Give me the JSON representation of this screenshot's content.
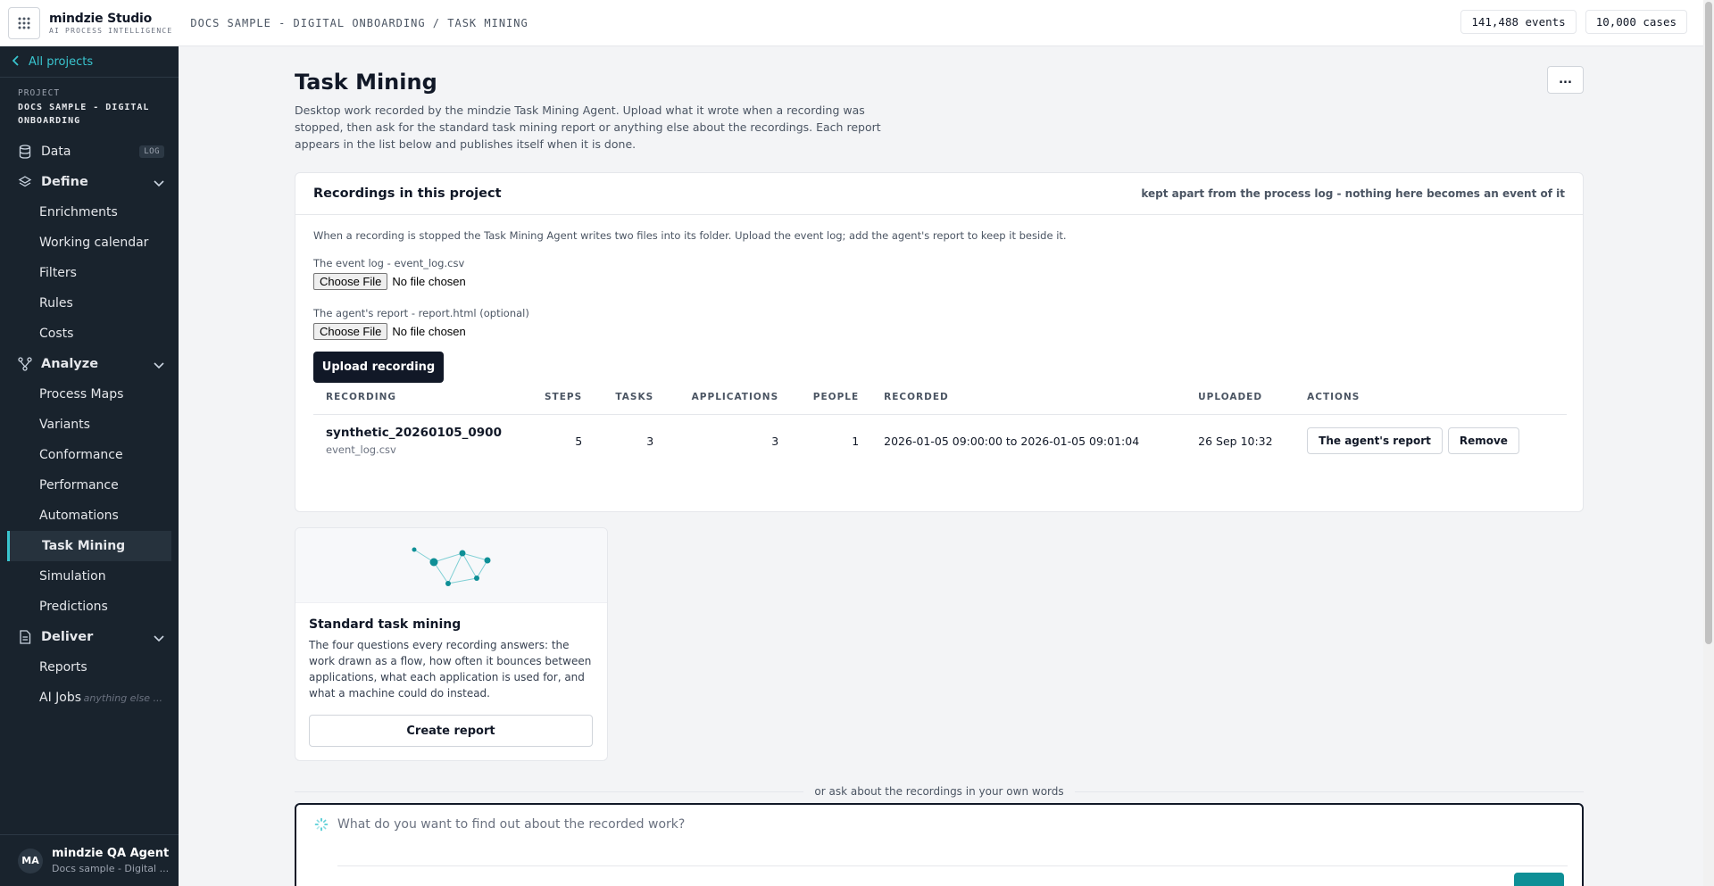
{
  "topbar": {
    "brand_name": "mindzie Studio",
    "brand_sub": "AI PROCESS INTELLIGENCE",
    "breadcrumb": "DOCS SAMPLE - DIGITAL ONBOARDING / TASK MINING",
    "events": "141,488 events",
    "cases": "10,000 cases"
  },
  "sidebar": {
    "back_label": "All projects",
    "project_label": "PROJECT",
    "project_name": "DOCS SAMPLE - DIGITAL ONBOARDING",
    "data_label": "Data",
    "data_badge": "LOG",
    "define": {
      "label": "Define",
      "items": [
        "Enrichments",
        "Working calendar",
        "Filters",
        "Rules",
        "Costs"
      ]
    },
    "analyze": {
      "label": "Analyze",
      "items": [
        "Process Maps",
        "Variants",
        "Conformance",
        "Performance",
        "Automations",
        "Task Mining",
        "Simulation",
        "Predictions"
      ]
    },
    "deliver": {
      "label": "Deliver",
      "items": [
        "Reports",
        "AI Jobs"
      ],
      "ai_jobs_hint": "anything else ..."
    },
    "active_item": "Task Mining",
    "user": {
      "initials": "MA",
      "name": "mindzie QA Agent",
      "project": "Docs sample - Digital ..."
    }
  },
  "page": {
    "title": "Task Mining",
    "description": "Desktop work recorded by the mindzie Task Mining Agent. Upload what it wrote when a recording was stopped, then ask for the standard task mining report or anything else about the recordings. Each report appears in the list below and publishes itself when it is done.",
    "more_label": "..."
  },
  "recordings": {
    "title": "Recordings in this project",
    "note": "kept apart from the process log - nothing here becomes an event of it",
    "hint": "When a recording is stopped the Task Mining Agent writes two files into its folder. Upload the event log; add the agent's report to keep it beside it.",
    "event_log_label": "The event log - event_log.csv",
    "report_label": "The agent's report - report.html (optional)",
    "choose_label": "Choose File",
    "no_file": "No file chosen",
    "upload_label": "Upload recording",
    "columns": [
      "RECORDING",
      "STEPS",
      "TASKS",
      "APPLICATIONS",
      "PEOPLE",
      "RECORDED",
      "UPLOADED",
      "ACTIONS"
    ],
    "rows": [
      {
        "name": "synthetic_20260105_0900",
        "file": "event_log.csv",
        "steps": "5",
        "tasks": "3",
        "applications": "3",
        "people": "1",
        "recorded": "2026-01-05 09:00:00 to 2026-01-05 09:01:04",
        "uploaded": "26 Sep 10:32",
        "action_report": "The agent's report",
        "action_remove": "Remove"
      }
    ]
  },
  "tile": {
    "title": "Standard task mining",
    "description": "The four questions every recording answers: the work drawn as a flow, how often it bounces between applications, what each application is used for, and what a machine could do instead.",
    "button": "Create report"
  },
  "ask": {
    "divider": "or ask about the recordings in your own words",
    "placeholder": "What do you want to find out about the recorded work?"
  },
  "colors": {
    "accent": "#39c5cf",
    "sidebar": "#19232d",
    "primary_button": "#111827"
  }
}
